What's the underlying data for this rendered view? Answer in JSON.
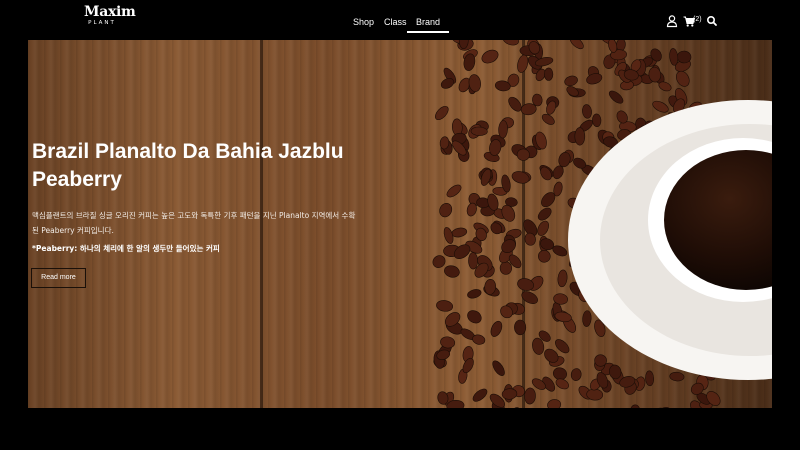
{
  "brand": {
    "name": "Maxim",
    "sub": "PLANT"
  },
  "nav": {
    "items": [
      "Shop",
      "Class",
      "Brand"
    ],
    "active": "Brand"
  },
  "header": {
    "user_icon": "user-icon",
    "cart_icon": "cart-icon",
    "cart_count": "(2)",
    "search_icon": "search-icon"
  },
  "hero": {
    "title": "Brazil Planalto Da Bahia Jazblu Peaberry",
    "description": "맥심플랜트의 브라질 싱글 오리진 커피는 높은 고도와 독특한 기후 패턴을 지닌 Planalto 지역에서 수확된 Peaberry 커피입니다.",
    "note": "*Peaberry: 하나의 체리에 한 알의 생두만 들어있는 커피",
    "button": "Read more"
  },
  "colors": {
    "background": "#000000",
    "wood": "#7b4d2b",
    "cup": "#ffffff",
    "coffee": "#1a0b05",
    "bean": "#3b2114"
  }
}
